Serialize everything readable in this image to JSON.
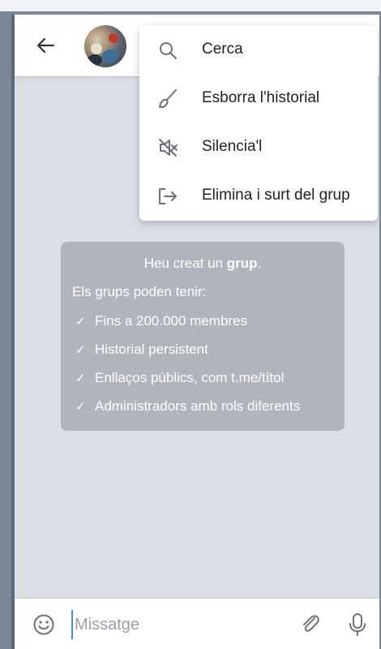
{
  "chat": {
    "message_input_placeholder": "Missatge"
  },
  "menu": {
    "items": [
      {
        "label": "Cerca",
        "icon": "search-icon"
      },
      {
        "label": "Esborra l'historial",
        "icon": "broom-icon"
      },
      {
        "label": "Silencia'l",
        "icon": "mute-icon"
      },
      {
        "label": "Elimina i surt del grup",
        "icon": "leave-icon"
      }
    ]
  },
  "service_message": {
    "title_prefix": "Heu creat un",
    "title_bold": "grup",
    "title_suffix": ".",
    "subtitle": "Els grups poden tenir:",
    "features": [
      "Fins a 200.000 membres",
      "Historial persistent",
      "Enllaços públics, com t.me/títol",
      "Administradors amb rols diferents"
    ]
  },
  "colors": {
    "background": "#dadfe6",
    "service_bubble": "#b0b4bd",
    "icon_gray": "#6b7178"
  }
}
